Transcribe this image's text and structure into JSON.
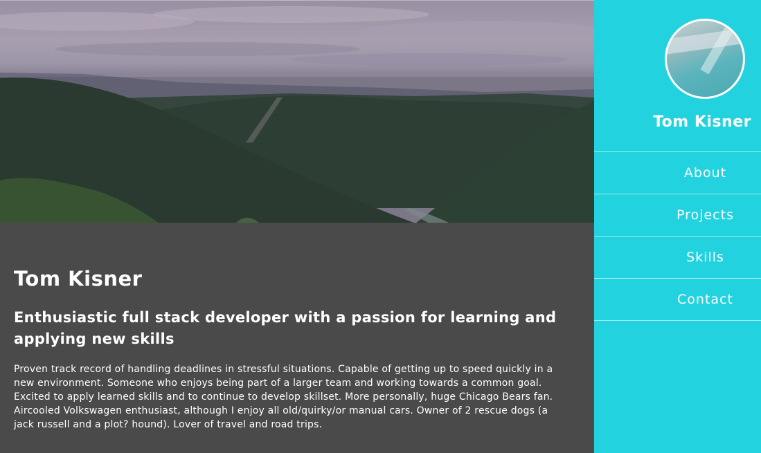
{
  "hero": {
    "image": "forested-valley-landscape"
  },
  "main": {
    "name": "Tom Kisner",
    "tagline": "Enthusiastic full stack developer with a passion for learning and applying new skills",
    "bio": "Proven track record of handling deadlines in stressful situations. Capable of getting up to speed quickly in a new environment. Someone who enjoys being part of a larger team and working towards a common goal. Excited to apply learned skills and to continue to develop skillset. More personally, huge Chicago Bears fan. Aircooled Volkswagen enthusiast, although I enjoy all old/quirky/or manual cars. Owner of 2 rescue dogs (a jack russell and a plot? hound). Lover of travel and road trips."
  },
  "sidebar": {
    "name": "Tom Kisner",
    "avatar": "profile-photo",
    "nav": [
      {
        "label": "About"
      },
      {
        "label": "Projects"
      },
      {
        "label": "Skills"
      },
      {
        "label": "Contact"
      }
    ]
  },
  "colors": {
    "sidebar_bg": "#22d3df",
    "content_bg": "#4a4a4a",
    "text": "#ffffff"
  }
}
